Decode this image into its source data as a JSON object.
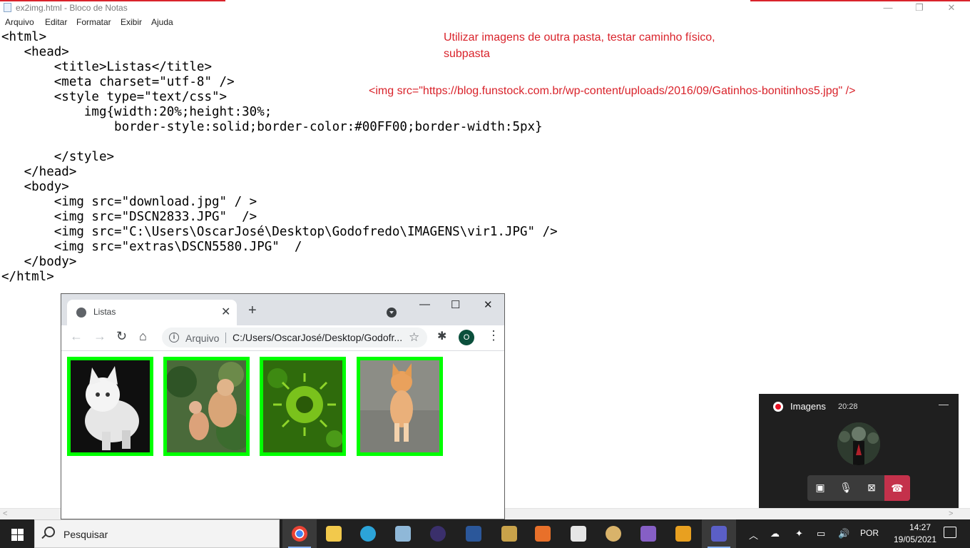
{
  "notepad": {
    "title": "ex2img.html - Bloco de Notas",
    "menu": [
      "Arquivo",
      "Editar",
      "Formatar",
      "Exibir",
      "Ajuda"
    ],
    "code": "<html>\n   <head>\n       <title>Listas</title>\n       <meta charset=\"utf-8\" />\n       <style type=\"text/css\">\n           img{width:20%;height:30%;\n               border-style:solid;border-color:#00FF00;border-width:5px}\n\n       </style>\n   </head>\n   <body>\n       <img src=\"download.jpg\" / >\n       <img src=\"DSCN2833.JPG\"  />\n       <img src=\"C:\\Users\\OscarJosé\\Desktop\\Godofredo\\IMAGENS\\vir1.JPG\" />\n       <img src=\"extras\\DSCN5580.JPG\"  /\n   </body>\n</html>",
    "note": "Utilizar imagens de outra pasta, testar caminho físico, subpasta",
    "img_line": "<img src=\"https://blog.funstock.com.br/wp-content/uploads/2016/09/Gatinhos-bonitinhos5.jpg\"  />",
    "window_controls": [
      "—",
      "❐",
      "✕"
    ]
  },
  "browser": {
    "tab_title": "Listas",
    "address_label": "Arquivo",
    "url": "C:/Users/OscarJosé/Desktop/Godofr...",
    "profile_initial": "O",
    "window_controls": [
      "—",
      "☐",
      "✕"
    ],
    "images": [
      {
        "desc": "white kitten",
        "frame_color": "#00FF00"
      },
      {
        "desc": "kittens in garden",
        "frame_color": "#00FF00"
      },
      {
        "desc": "green virus",
        "frame_color": "#00FF00"
      },
      {
        "desc": "orange kitten",
        "frame_color": "#00FF00"
      }
    ]
  },
  "teams": {
    "title": "Imagens",
    "timer": "20:28",
    "min": "—"
  },
  "taskbar": {
    "search_placeholder": "Pesquisar",
    "language": "POR",
    "time": "14:27",
    "date": "19/05/2021",
    "apps": [
      "chrome-icon",
      "file-explorer-icon",
      "edge-icon",
      "virtualbox-icon",
      "eclipse-icon",
      "word-icon",
      "tools-icon",
      "media-player-icon",
      "solitaire-icon",
      "paint-icon",
      "visual-studio-icon",
      "app-icon",
      "teams-icon"
    ]
  },
  "colors": {
    "accent_red": "#d9232b",
    "border_green": "#00FF00",
    "taskbar": "#202020"
  }
}
